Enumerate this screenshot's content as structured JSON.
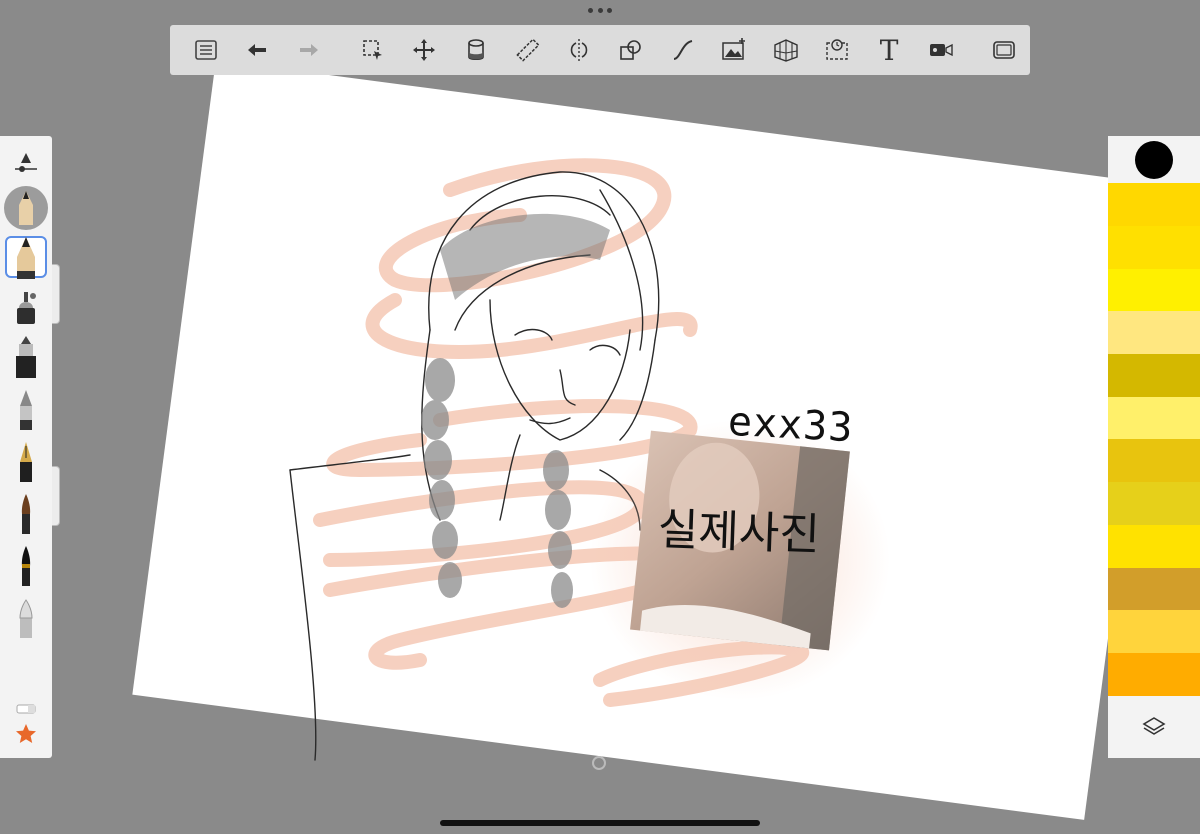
{
  "toolbar": {
    "buttons": [
      {
        "id": "menu",
        "icon": "list-icon"
      },
      {
        "id": "undo",
        "icon": "undo-arrow-icon"
      },
      {
        "id": "redo",
        "icon": "redo-arrow-icon"
      },
      {
        "id": "select",
        "icon": "selection-icon"
      },
      {
        "id": "transform",
        "icon": "move-icon"
      },
      {
        "id": "fill",
        "icon": "fill-bucket-icon"
      },
      {
        "id": "ruler",
        "icon": "ruler-icon"
      },
      {
        "id": "symmetry",
        "icon": "symmetry-icon"
      },
      {
        "id": "shapes",
        "icon": "shapes-icon"
      },
      {
        "id": "curve",
        "icon": "curve-icon"
      },
      {
        "id": "image",
        "icon": "add-image-icon"
      },
      {
        "id": "perspective",
        "icon": "perspective-grid-icon"
      },
      {
        "id": "timelapse",
        "icon": "timelapse-icon"
      },
      {
        "id": "text",
        "icon": "text-icon",
        "label": "T"
      },
      {
        "id": "record",
        "icon": "video-icon"
      },
      {
        "id": "fullscreen",
        "icon": "fullscreen-icon"
      }
    ]
  },
  "left_panel": {
    "tools": [
      "pencil",
      "airbrush",
      "marker",
      "ballpoint",
      "fountain-pen",
      "paintbrush",
      "ink-brush",
      "smudge"
    ],
    "active_tool": "pencil"
  },
  "right_panel": {
    "current_color": "#000000",
    "swatches": [
      "#FFD800",
      "#FFE000",
      "#FFF000",
      "#FFE780",
      "#D4B800",
      "#FFF06A",
      "#E8C40E",
      "#E6D01A",
      "#FFE200",
      "#D29E2A",
      "#FFD43C",
      "#FFAC00"
    ]
  },
  "canvas": {
    "handwriting_top": "exx33",
    "handwriting_korean": "실제사진"
  }
}
